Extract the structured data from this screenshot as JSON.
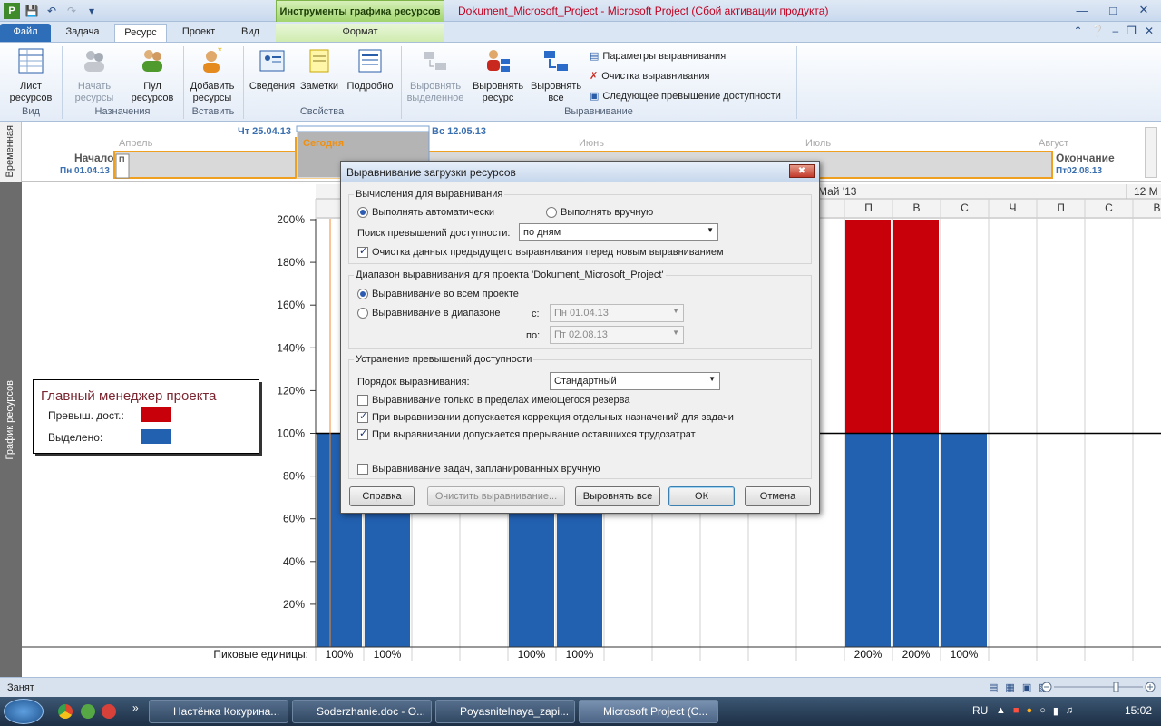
{
  "window": {
    "context_group": "Инструменты графика ресурсов",
    "title": "Dokument_Microsoft_Project  -  Microsoft Project (Сбой активации продукта)"
  },
  "tabs": [
    "Файл",
    "Задача",
    "Ресурс",
    "Проект",
    "Вид",
    "Формат"
  ],
  "ribbon": {
    "view": {
      "list_label": "Лист ресурсов",
      "group": "Вид"
    },
    "assign": {
      "start_label": "Начать ресурсы",
      "pool_label": "Пул ресурсов",
      "group": "Назначения"
    },
    "insert": {
      "add_label": "Добавить ресурсы",
      "group": "Вставить"
    },
    "props": {
      "info_label": "Сведения",
      "notes_label": "Заметки",
      "details_label": "Подробно",
      "group": "Свойства"
    },
    "level": {
      "selected_label": "Выровнять выделенное",
      "resource_label": "Выровнять ресурс",
      "all_label": "Выровнять все",
      "options_label": "Параметры выравнивания",
      "clear_label": "Очистка выравнивания",
      "next_label": "Следующее превышение доступности",
      "group": "Выравнивание"
    }
  },
  "timeline": {
    "side_label": "Временная",
    "date1": "Чт 25.04.13",
    "date2": "Вс 12.05.13",
    "today": "Сегодня",
    "months": [
      "Апрель",
      "Июнь",
      "Июль",
      "Август"
    ],
    "start_label": "Начало",
    "start_date": "Пн 01.04.13",
    "end_label": "Окончание",
    "end_date": "Пт02.08.13",
    "bar_letters": "П"
  },
  "graph": {
    "side_label": "График ресурсов",
    "legend_title": "Главный менеджер проекта",
    "legend_over": "Превыш. дост.:",
    "legend_alloc": "Выделено:",
    "colors": {
      "over": "#c8000a",
      "alloc": "#2260b0"
    },
    "week_label": "Май '13",
    "week2_label": "12 М",
    "day_headers": [
      "П",
      "В",
      "С",
      "Ч",
      "П",
      "С",
      "В"
    ],
    "peak_label": "Пиковые единицы:",
    "peaks": [
      "100%",
      "100%",
      "100%",
      "100%",
      "200%",
      "200%",
      "100%"
    ]
  },
  "chart_data": {
    "type": "bar",
    "ylim": [
      0,
      200
    ],
    "yticks": [
      "20%",
      "40%",
      "60%",
      "80%",
      "100%",
      "120%",
      "140%",
      "160%",
      "180%",
      "200%"
    ],
    "series": [
      {
        "name": "Выделено",
        "values": [
          100,
          100,
          100,
          100,
          100,
          100,
          100
        ]
      },
      {
        "name": "Превыш. дост.",
        "values": [
          0,
          0,
          0,
          0,
          100,
          100,
          0
        ]
      }
    ]
  },
  "dialog": {
    "title": "Выравнивание загрузки ресурсов",
    "calc_legend": "Вычисления для выравнивания",
    "auto": "Выполнять автоматически",
    "manual": "Выполнять вручную",
    "search_label": "Поиск превышений доступности:",
    "search_value": "по дням",
    "clear_prev": "Очистка данных предыдущего выравнивания перед новым выравниванием",
    "range_legend": "Диапазон выравнивания для проекта 'Dokument_Microsoft_Project'",
    "whole": "Выравнивание во всем проекте",
    "in_range": "Выравнивание в диапазоне",
    "from_label": "с:",
    "from_value": "Пн 01.04.13",
    "to_label": "по:",
    "to_value": "Пт 02.08.13",
    "resolve_legend": "Устранение превышений доступности",
    "order_label": "Порядок выравнивания:",
    "order_value": "Стандартный",
    "opt1": "Выравнивание только в пределах имеющегося резерва",
    "opt2": "При выравнивании допускается коррекция отдельных назначений для задачи",
    "opt3": "При выравнивании допускается прерывание оставшихся трудозатрат",
    "opt4": "Выравнивание задач, запланированных вручную",
    "btn_help": "Справка",
    "btn_clear": "Очистить выравнивание...",
    "btn_all": "Выровнять все",
    "btn_ok": "ОК",
    "btn_cancel": "Отмена"
  },
  "status": {
    "text": "Занят"
  },
  "taskbar": {
    "items": [
      "Настёнка Кокурина...",
      "Soderzhanie.doc - O...",
      "Poyasnitelnaya_zapi...",
      "Microsoft Project (C..."
    ],
    "lang": "RU",
    "time": "15:02"
  }
}
